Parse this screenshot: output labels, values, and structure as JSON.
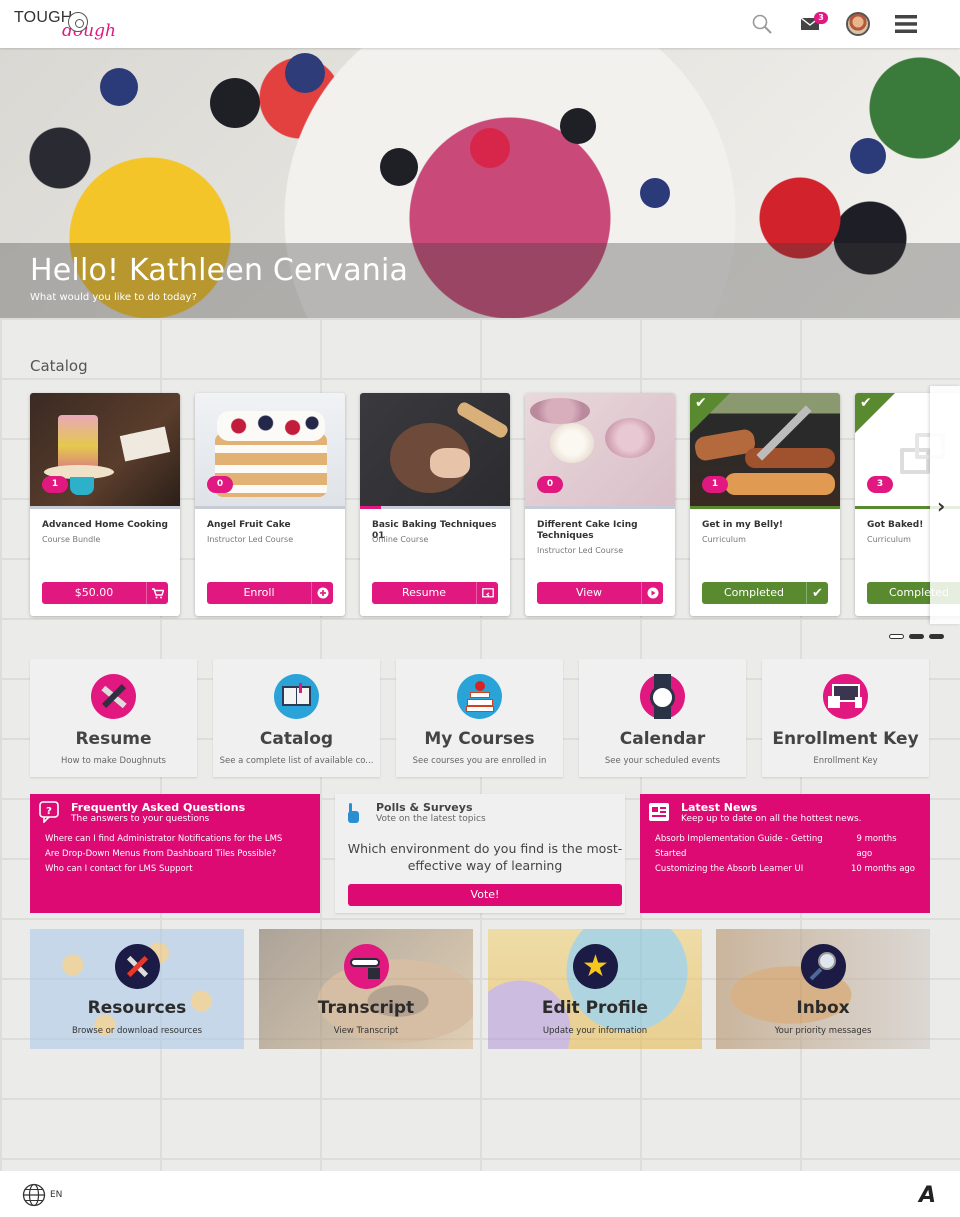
{
  "brand": {
    "name_top": "TOUGH",
    "name_script": "dough",
    "accent": "#e0187f",
    "success": "#5a8a30"
  },
  "header": {
    "icons": [
      "search-icon",
      "mail-icon",
      "avatar",
      "hamburger-menu-icon"
    ],
    "mail_badge": "3"
  },
  "hero": {
    "title": "Hello! Kathleen Cervania",
    "subtitle": "What would you like to do today?"
  },
  "catalog": {
    "title": "Catalog",
    "cards": [
      {
        "name": "Advanced Home Cooking",
        "type": "Course Bundle",
        "count": "1",
        "button": "$50.00",
        "button_icon": "cart-icon",
        "status": "none",
        "progress": 0
      },
      {
        "name": "Angel Fruit Cake",
        "type": "Instructor Led Course",
        "count": "0",
        "button": "Enroll",
        "button_icon": "plus-circle-icon",
        "status": "none",
        "progress": 0
      },
      {
        "name": "Basic Baking Techniques 01",
        "type": "Online Course",
        "count": "",
        "button": "Resume",
        "button_icon": "resume-screen-icon",
        "status": "in-progress",
        "progress": 0.14
      },
      {
        "name": "Different Cake Icing Techniques",
        "type": "Instructor Led Course",
        "count": "0",
        "button": "View",
        "button_icon": "play-circle-icon",
        "status": "none",
        "progress": 0
      },
      {
        "name": "Get in my Belly!",
        "type": "Curriculum",
        "count": "1",
        "button": "Completed",
        "button_icon": "check-icon",
        "status": "completed",
        "progress": 1
      },
      {
        "name": "Got Baked!",
        "type": "Curriculum",
        "count": "3",
        "button": "Completed",
        "button_icon": "check-icon",
        "status": "completed",
        "progress": 1
      }
    ],
    "pagination": {
      "pages": 3,
      "current": 1
    }
  },
  "tiles": [
    {
      "title": "Resume",
      "subtitle": "How to make Doughnuts",
      "icon": "pencil-ruler-icon"
    },
    {
      "title": "Catalog",
      "subtitle": "See a complete list of available co...",
      "icon": "open-book-icon"
    },
    {
      "title": "My Courses",
      "subtitle": "See courses you are enrolled in",
      "icon": "books-apple-icon"
    },
    {
      "title": "Calendar",
      "subtitle": "See your scheduled events",
      "icon": "watch-icon"
    },
    {
      "title": "Enrollment Key",
      "subtitle": "Enrollment Key",
      "icon": "devices-icon"
    }
  ],
  "faq": {
    "title": "Frequently Asked Questions",
    "subtitle": "The answers to your questions",
    "items": [
      "Where can I find Administrator Notifications for the LMS",
      "Are Drop-Down Menus From Dashboard Tiles Possible?",
      "Who can I contact for LMS Support"
    ]
  },
  "polls": {
    "title": "Polls & Surveys",
    "subtitle": "Vote on the latest topics",
    "question": "Which environment do you find is the most-effective way of learning",
    "vote_label": "Vote!"
  },
  "news": {
    "title": "Latest News",
    "subtitle": "Keep up to date on all the hottest news.",
    "items": [
      {
        "title": "Absorb Implementation Guide - Getting Started",
        "age": "9 months ago"
      },
      {
        "title": "Customizing the Absorb Learner UI",
        "age": "10 months ago"
      }
    ]
  },
  "bottom_tiles": [
    {
      "title": "Resources",
      "subtitle": "Browse or download resources",
      "icon": "tools-icon"
    },
    {
      "title": "Transcript",
      "subtitle": "View Transcript",
      "icon": "password-lock-icon"
    },
    {
      "title": "Edit Profile",
      "subtitle": "Update your information",
      "icon": "star-icon"
    },
    {
      "title": "Inbox",
      "subtitle": "Your priority messages",
      "icon": "magnifier-icon"
    }
  ],
  "footer": {
    "language": "EN",
    "logo_letter": "A"
  }
}
